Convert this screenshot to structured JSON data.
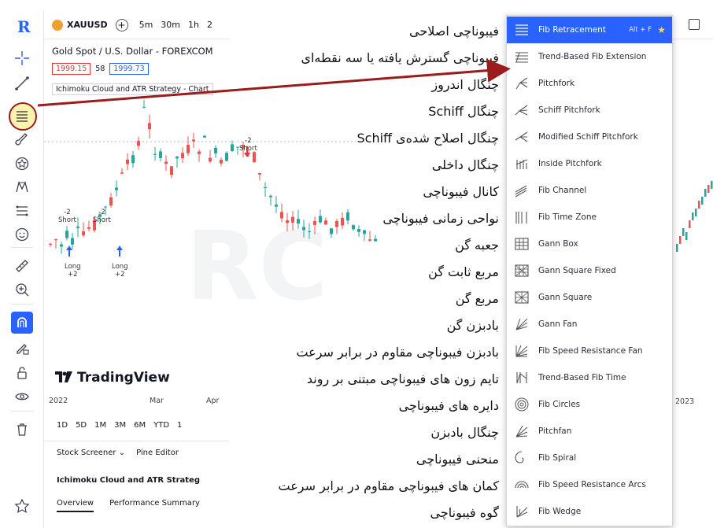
{
  "toolbar": {
    "logo": "R",
    "icons": [
      "crosshair-icon",
      "trend-line-icon",
      "fib-retracement-icon",
      "brush-icon",
      "favorite-patterns-icon",
      "xabcd-pattern-icon",
      "prediction-icon",
      "emoji-icon",
      "ruler-icon",
      "zoom-in-icon",
      "magnet-icon",
      "lock-drawing-icon",
      "lock-icon",
      "eye-icon",
      "trash-icon",
      "star-icon"
    ]
  },
  "topbar": {
    "symbol": "XAUUSD",
    "timeframes": [
      "5m",
      "30m",
      "1h",
      "2"
    ]
  },
  "chart": {
    "title": "Gold Spot / U.S. Dollar - FOREXCOM",
    "sell_price": "1999.15",
    "spread": "58",
    "buy_price": "1999.73",
    "indicator": "Ichimoku Cloud and ATR Strategy - Chart",
    "signals": [
      {
        "text": "-2\nShort"
      },
      {
        "text": "-2\nShort"
      },
      {
        "text": "-2\nShort"
      },
      {
        "text": "Long\n+2"
      },
      {
        "text": "Long\n+2"
      }
    ],
    "brand": "TradingView",
    "watermark": "RC"
  },
  "date_axis": [
    "2022",
    "Mar",
    "Apr"
  ],
  "right_axis_year": "2023",
  "ranges": [
    "1D",
    "5D",
    "1M",
    "3M",
    "6M",
    "YTD",
    "1"
  ],
  "bottom_tabs": [
    "Stock Screener",
    "Pine Editor"
  ],
  "strategy": {
    "title": "Ichimoku Cloud and ATR Strateg",
    "tabs": [
      "Overview",
      "Performance Summary"
    ]
  },
  "menu": {
    "shortcut": "Alt + F",
    "items": [
      {
        "label": "Fib Retracement",
        "icon": "fib-retracement-icon",
        "fa": "فیبوناچی اصلاحی",
        "fa_bold": ""
      },
      {
        "label": "Trend-Based Fib Extension",
        "icon": "fib-extension-icon",
        "fa": "فیبوناچی گسترش یافته یا سه نقطه‌ای",
        "fa_bold": ""
      },
      {
        "label": "Pitchfork",
        "icon": "pitchfork-icon",
        "fa": "چنگال اندروز",
        "fa_bold": ""
      },
      {
        "label": "Schiff Pitchfork",
        "icon": "schiff-pitchfork-icon",
        "fa": "چنگال Schiff",
        "fa_bold": ""
      },
      {
        "label": "Modified Schiff Pitchfork",
        "icon": "modified-schiff-icon",
        "fa": "چنگال اصلاح شده‌ی Schiff",
        "fa_bold": ""
      },
      {
        "label": "Inside Pitchfork",
        "icon": "inside-pitchfork-icon",
        "fa": "چنگال داخلی",
        "fa_bold": ""
      },
      {
        "label": "Fib Channel",
        "icon": "fib-channel-icon",
        "fa": "کانال فیبوناچی",
        "fa_bold": ""
      },
      {
        "label": "Fib Time Zone",
        "icon": "fib-time-zone-icon",
        "fa": "نواحی زمانی فیبوناچی",
        "fa_bold": ""
      },
      {
        "label": "Gann Box",
        "icon": "gann-box-icon",
        "fa": "جعبه گن",
        "fa_bold": ""
      },
      {
        "label": "Gann Square Fixed",
        "icon": "gann-square-fixed-icon",
        "fa": "مربع ثابت گن",
        "fa_bold": ""
      },
      {
        "label": "Gann Square",
        "icon": "gann-square-icon",
        "fa": "مربع گن",
        "fa_bold": ""
      },
      {
        "label": "Gann Fan",
        "icon": "gann-fan-icon",
        "fa": "بادبزن گن",
        "fa_bold": ""
      },
      {
        "label": "Fib Speed Resistance Fan",
        "icon": "fib-speed-fan-icon",
        "fa": "بادبزن فیبوناچی مقاوم در برابر سرعت",
        "fa_bold": ""
      },
      {
        "label": "Trend-Based Fib Time",
        "icon": "fib-time-icon",
        "fa": "تایم زون های فیبوناچی مبتنی بر روند",
        "fa_bold": ""
      },
      {
        "label": "Fib Circles",
        "icon": "fib-circles-icon",
        "fa": "دایره های فیبوناچی",
        "fa_bold": ""
      },
      {
        "label": "Pitchfan",
        "icon": "pitchfan-icon",
        "fa": "چنگال بادبزن",
        "fa_bold": ""
      },
      {
        "label": "Fib Spiral",
        "icon": "fib-spiral-icon",
        "fa": "منحنی فیبوناچی",
        "fa_bold": ""
      },
      {
        "label": "Fib Speed Resistance Arcs",
        "icon": "fib-speed-arcs-icon",
        "fa": "کمان های فیبوناچی مقاوم در برابر سرعت",
        "fa_bold": ""
      },
      {
        "label": "Fib Wedge",
        "icon": "fib-wedge-icon",
        "fa": "گوه فیبوناچی",
        "fa_bold": ""
      }
    ]
  },
  "colors": {
    "accent": "#2962ff",
    "arrow": "#9b1c1c",
    "up_candle": "#26a69a",
    "down_candle": "#ef5350"
  }
}
